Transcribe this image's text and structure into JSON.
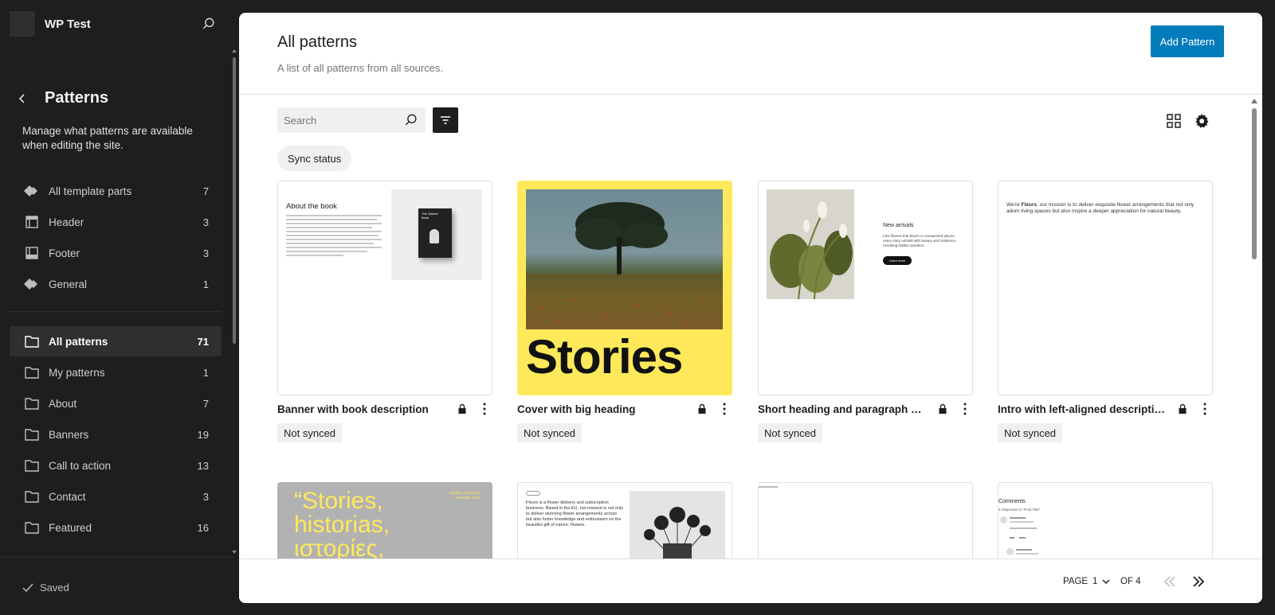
{
  "site": {
    "title": "WP Test"
  },
  "sidebar": {
    "title": "Patterns",
    "description": "Manage what patterns are available when editing the site.",
    "template_parts": [
      {
        "label": "All template parts",
        "count": "7",
        "icon": "diamond-icon"
      },
      {
        "label": "Header",
        "count": "3",
        "icon": "header-icon"
      },
      {
        "label": "Footer",
        "count": "3",
        "icon": "footer-icon"
      },
      {
        "label": "General",
        "count": "1",
        "icon": "diamond-icon"
      }
    ],
    "categories": [
      {
        "label": "All patterns",
        "count": "71",
        "active": true
      },
      {
        "label": "My patterns",
        "count": "1"
      },
      {
        "label": "About",
        "count": "7"
      },
      {
        "label": "Banners",
        "count": "19"
      },
      {
        "label": "Call to action",
        "count": "13"
      },
      {
        "label": "Contact",
        "count": "3"
      },
      {
        "label": "Featured",
        "count": "16"
      }
    ],
    "footer_status": "Saved"
  },
  "main": {
    "title": "All patterns",
    "subtitle": "A list of all patterns from all sources.",
    "add_button": "Add Pattern",
    "search_placeholder": "Search",
    "filter_chip": "Sync status",
    "cards": [
      {
        "title": "Banner with book description",
        "badge": "Not synced"
      },
      {
        "title": "Cover with big heading",
        "badge": "Not synced"
      },
      {
        "title": "Short heading and paragraph an...",
        "badge": "Not synced"
      },
      {
        "title": "Intro with left-aligned description",
        "badge": "Not synced"
      }
    ],
    "thumbs": {
      "book_heading": "About the book",
      "book_cover": "The Stories Book",
      "cover_heading": "Stories",
      "arrivals_heading": "New arrivals",
      "arrivals_text": "Like flowers that bloom in unexpected places, every story unfolds with beauty and resilience, revealing hidden wonders.",
      "arrivals_button": "Learn more",
      "intro_text_prefix": "We're ",
      "intro_brand": "Fleurs",
      "intro_text": ", our mission is to deliver exquisite flower arrangements that not only adorn living spaces but also inspire a deeper appreciation for natural beauty.",
      "quote_text": "“Stories, historias, ιστορίες,",
      "quote_side": "Sayulita, POC/SUN Yosemite Valley",
      "fleurs_text": "Fleurs is a flower delivery and subscription business. Based in the EU, our mission is not only to deliver stunning flower arrangements across but also foster knowledge and enthusiasm on the beautiful gift of nature: flowers.",
      "comments_heading": "Comments",
      "comments_sub": "3 responses to “Post Title”"
    }
  },
  "pagination": {
    "page_label": "PAGE",
    "current": "1",
    "of_label": "OF 4"
  },
  "colors": {
    "accent": "#007cba",
    "sidebar_bg": "#1e1e1e",
    "cover_yellow": "#ffe95a"
  }
}
